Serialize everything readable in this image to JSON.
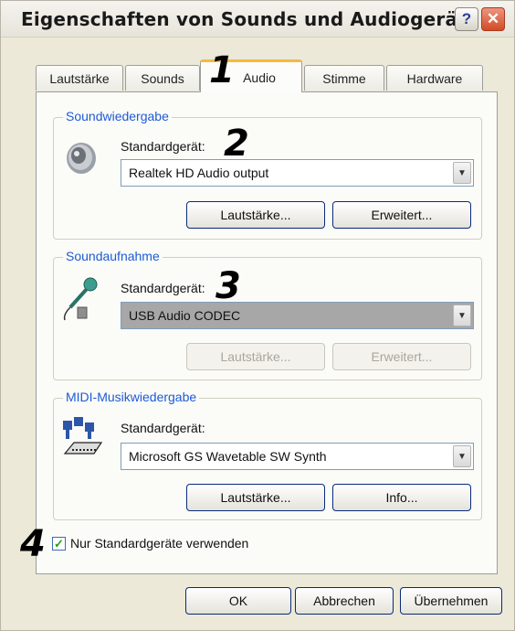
{
  "window": {
    "title": "Eigenschaften von Sounds und Audiogeräte"
  },
  "tabs": [
    "Lautstärke",
    "Sounds",
    "Audio",
    "Stimme",
    "Hardware"
  ],
  "active_tab": "Audio",
  "annotations": [
    "1",
    "2",
    "3",
    "4"
  ],
  "playback": {
    "title": "Soundwiedergabe",
    "default_label": "Standardgerät:",
    "device": "Realtek HD Audio output",
    "volume_button": "Lautstärke...",
    "advanced_button": "Erweitert..."
  },
  "recording": {
    "title": "Soundaufnahme",
    "default_label": "Standardgerät:",
    "device": "USB Audio CODEC",
    "volume_button": "Lautstärke...",
    "advanced_button": "Erweitert..."
  },
  "midi": {
    "title": "MIDI-Musikwiedergabe",
    "default_label": "Standardgerät:",
    "device": "Microsoft GS Wavetable SW Synth",
    "volume_button": "Lautstärke...",
    "info_button": "Info..."
  },
  "checkbox": {
    "label": "Nur Standardgeräte verwenden",
    "checked": true
  },
  "footer": {
    "ok": "OK",
    "cancel": "Abbrechen",
    "apply": "Übernehmen"
  },
  "colors": {
    "group_title": "#1c5bd6",
    "active_tab_accent": "#f6b93e",
    "close_button": "#d44a25"
  }
}
